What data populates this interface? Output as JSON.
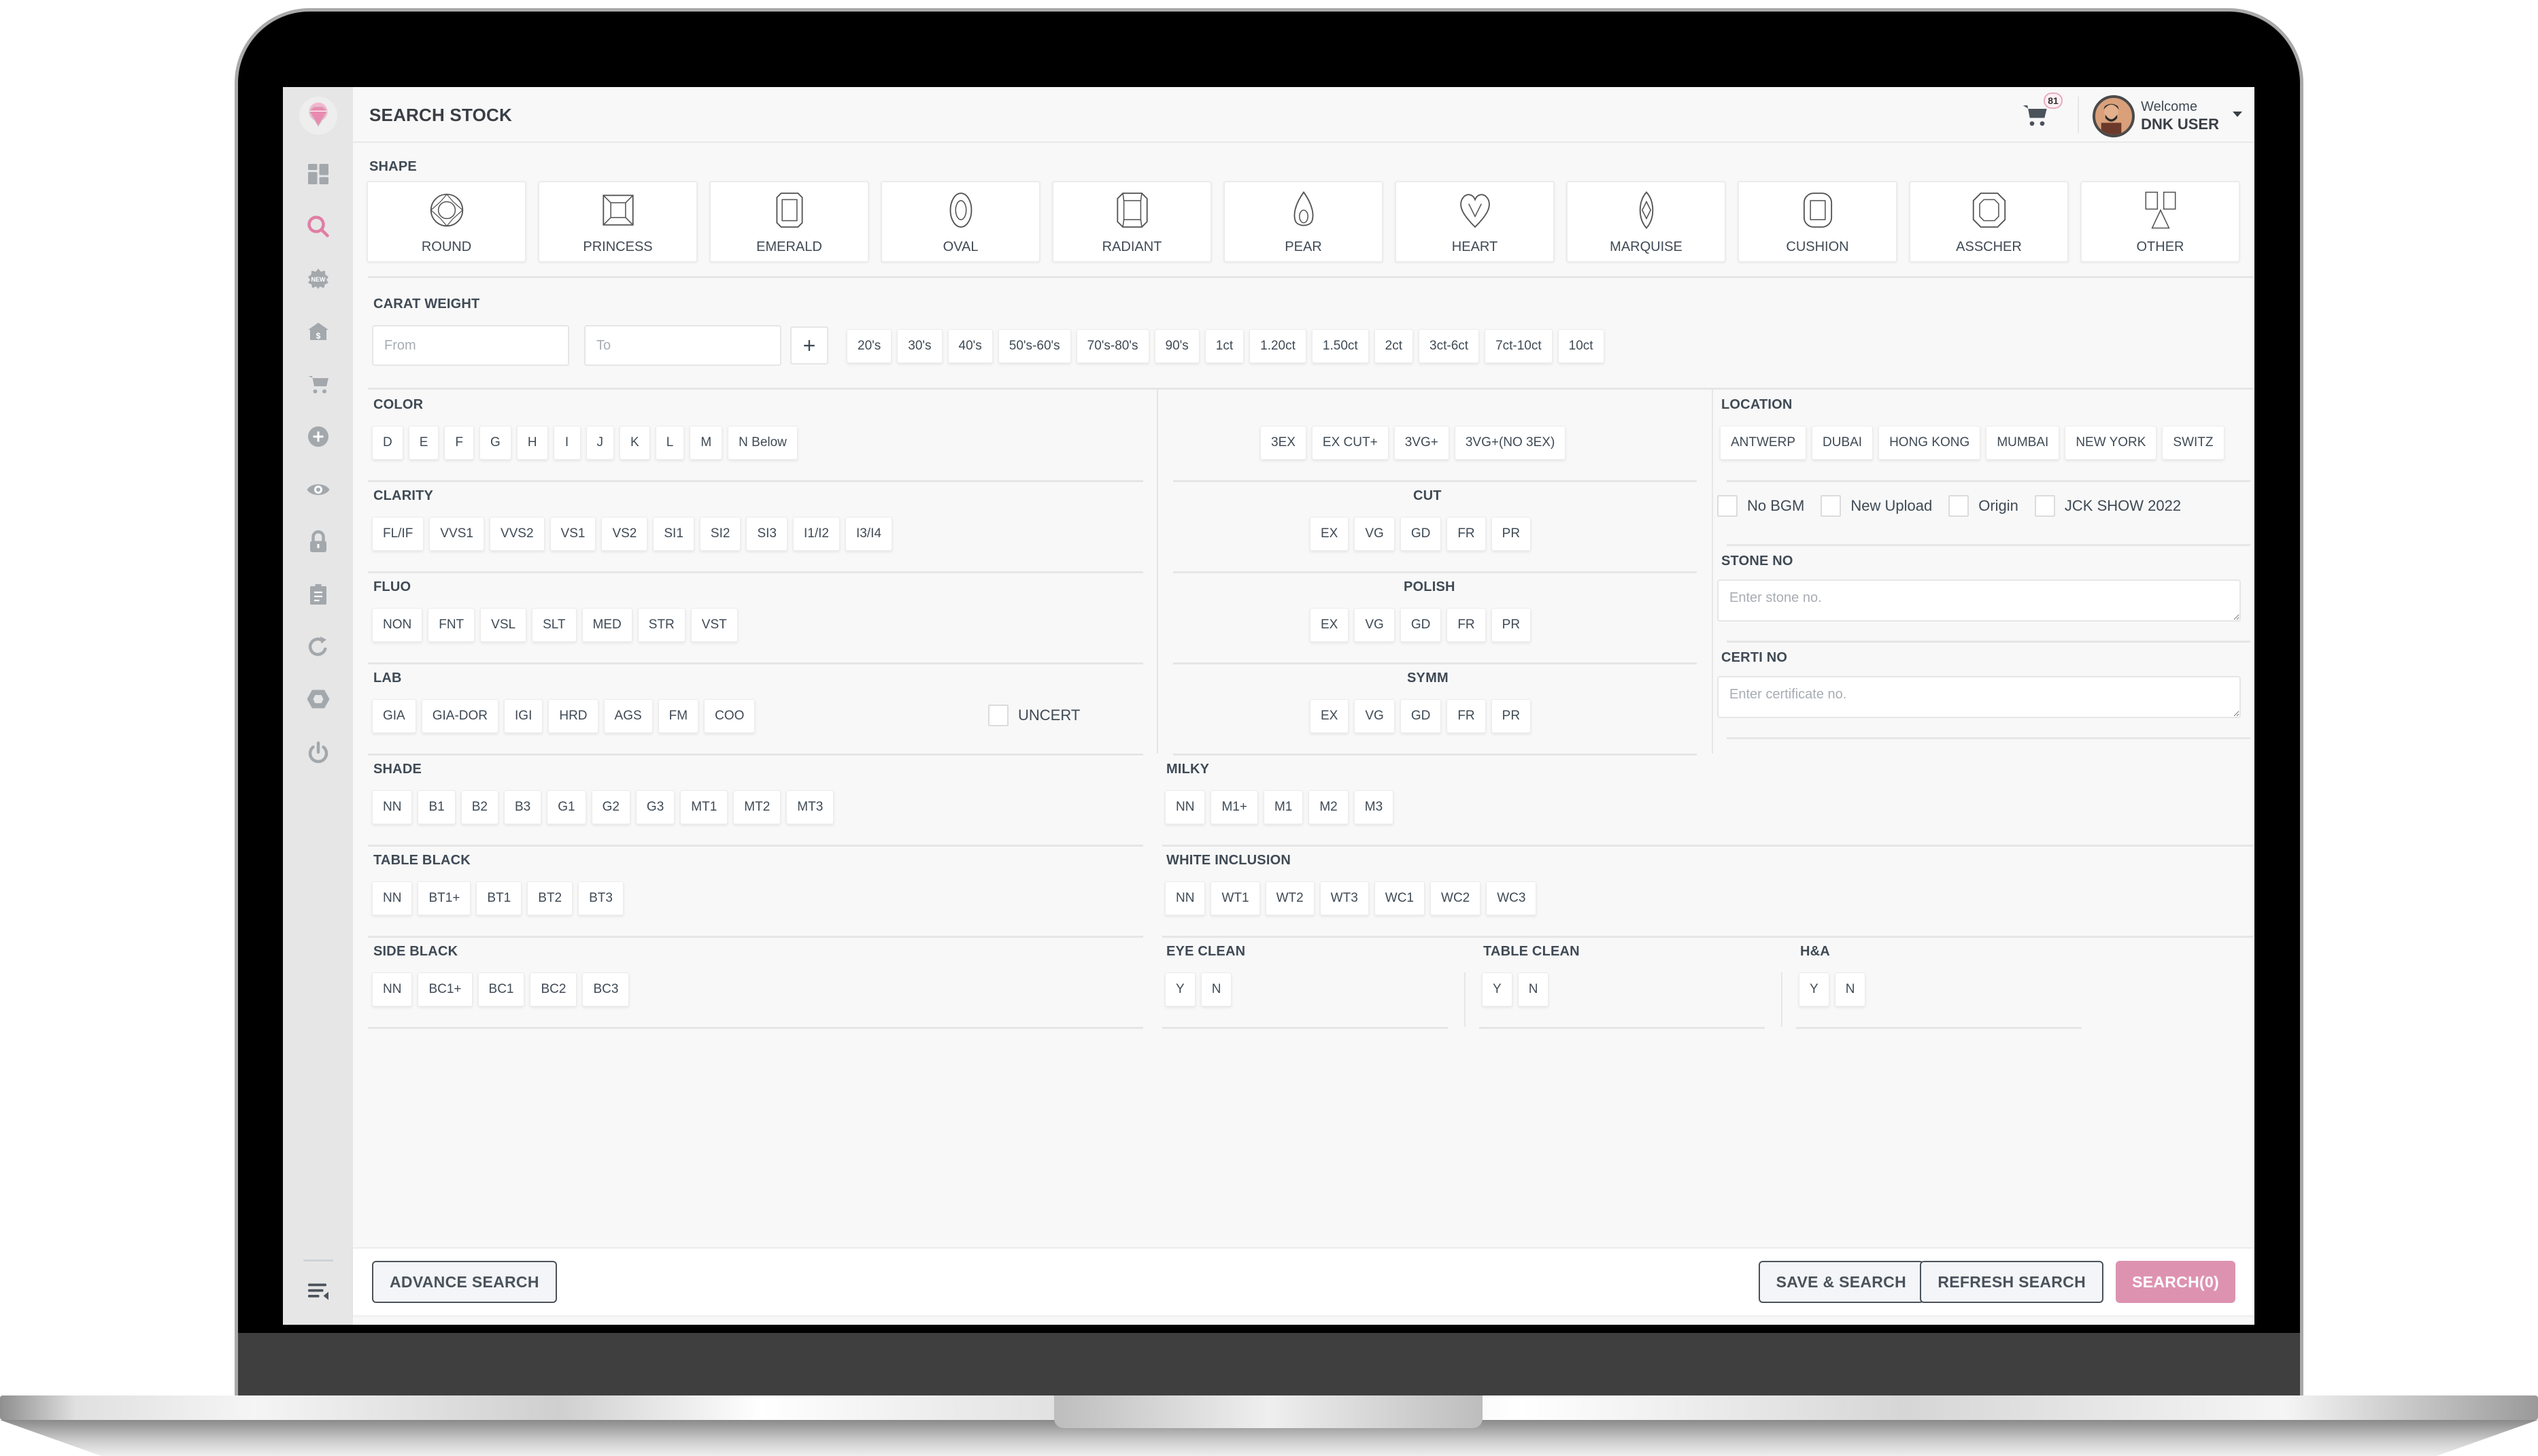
{
  "header": {
    "title": "SEARCH STOCK",
    "cart_count": "81",
    "welcome": "Welcome",
    "user_name": "DNK USER"
  },
  "sidebar": {
    "items": [
      {
        "name": "dashboard-icon"
      },
      {
        "name": "search-icon",
        "active": true
      },
      {
        "name": "new-badge-icon"
      },
      {
        "name": "bank-icon"
      },
      {
        "name": "cart-icon"
      },
      {
        "name": "add-circle-icon"
      },
      {
        "name": "eye-icon"
      },
      {
        "name": "lock-icon"
      },
      {
        "name": "clipboard-icon"
      },
      {
        "name": "refresh-icon"
      },
      {
        "name": "diamond-icon"
      },
      {
        "name": "power-icon"
      }
    ],
    "bottom_icon": "menu-collapse-icon"
  },
  "shape": {
    "label": "SHAPE",
    "items": [
      "ROUND",
      "PRINCESS",
      "EMERALD",
      "OVAL",
      "RADIANT",
      "PEAR",
      "HEART",
      "MARQUISE",
      "CUSHION",
      "ASSCHER",
      "OTHER"
    ]
  },
  "carat": {
    "label": "CARAT WEIGHT",
    "from_placeholder": "From",
    "to_placeholder": "To",
    "add_label": "+",
    "presets": [
      "20's",
      "30's",
      "40's",
      "50's-60's",
      "70's-80's",
      "90's",
      "1ct",
      "1.20ct",
      "1.50ct",
      "2ct",
      "3ct-6ct",
      "7ct-10ct",
      "10ct"
    ]
  },
  "color": {
    "label": "COLOR",
    "items": [
      "D",
      "E",
      "F",
      "G",
      "H",
      "I",
      "J",
      "K",
      "L",
      "M",
      "N Below"
    ]
  },
  "clarity": {
    "label": "CLARITY",
    "items": [
      "FL/IF",
      "VVS1",
      "VVS2",
      "VS1",
      "VS2",
      "SI1",
      "SI2",
      "SI3",
      "I1/I2",
      "I3/I4"
    ]
  },
  "fluo": {
    "label": "FLUO",
    "items": [
      "NON",
      "FNT",
      "VSL",
      "SLT",
      "MED",
      "STR",
      "VST"
    ]
  },
  "lab": {
    "label": "LAB",
    "items": [
      "GIA",
      "GIA-DOR",
      "IGI",
      "HRD",
      "AGS",
      "FM",
      "COO"
    ],
    "uncert_label": "UNCERT"
  },
  "make": {
    "items": [
      "3EX",
      "EX CUT+",
      "3VG+",
      "3VG+(NO 3EX)"
    ]
  },
  "cut": {
    "label": "CUT",
    "items": [
      "EX",
      "VG",
      "GD",
      "FR",
      "PR"
    ]
  },
  "polish": {
    "label": "POLISH",
    "items": [
      "EX",
      "VG",
      "GD",
      "FR",
      "PR"
    ]
  },
  "symm": {
    "label": "SYMM",
    "items": [
      "EX",
      "VG",
      "GD",
      "FR",
      "PR"
    ]
  },
  "location": {
    "label": "LOCATION",
    "items": [
      "ANTWERP",
      "DUBAI",
      "HONG KONG",
      "MUMBAI",
      "NEW YORK",
      "SWITZ"
    ]
  },
  "flags": [
    "No BGM",
    "New Upload",
    "Origin",
    "JCK SHOW 2022"
  ],
  "stone_no": {
    "label": "STONE NO",
    "placeholder": "Enter stone no."
  },
  "certi_no": {
    "label": "CERTI NO",
    "placeholder": "Enter certificate no."
  },
  "shade": {
    "label": "SHADE",
    "items": [
      "NN",
      "B1",
      "B2",
      "B3",
      "G1",
      "G2",
      "G3",
      "MT1",
      "MT2",
      "MT3"
    ]
  },
  "milky": {
    "label": "MILKY",
    "items": [
      "NN",
      "M1+",
      "M1",
      "M2",
      "M3"
    ]
  },
  "table_black": {
    "label": "TABLE BLACK",
    "items": [
      "NN",
      "BT1+",
      "BT1",
      "BT2",
      "BT3"
    ]
  },
  "white_inclusion": {
    "label": "WHITE INCLUSION",
    "items": [
      "NN",
      "WT1",
      "WT2",
      "WT3",
      "WC1",
      "WC2",
      "WC3"
    ]
  },
  "side_black": {
    "label": "SIDE BLACK",
    "items": [
      "NN",
      "BC1+",
      "BC1",
      "BC2",
      "BC3"
    ]
  },
  "eye_clean": {
    "label": "EYE CLEAN",
    "items": [
      "Y",
      "N"
    ]
  },
  "table_clean": {
    "label": "TABLE CLEAN",
    "items": [
      "Y",
      "N"
    ]
  },
  "ha": {
    "label": "H&A",
    "items": [
      "Y",
      "N"
    ]
  },
  "footer": {
    "advance_search": "ADVANCE SEARCH",
    "save_search": "SAVE & SEARCH",
    "refresh_search": "REFRESH SEARCH",
    "search": "SEARCH(0)"
  },
  "colors": {
    "accent_pink": "#dd93b0",
    "sidebar_bg": "#e6e6e6",
    "page_bg": "#f8f8f8",
    "text": "#3f4a55"
  }
}
